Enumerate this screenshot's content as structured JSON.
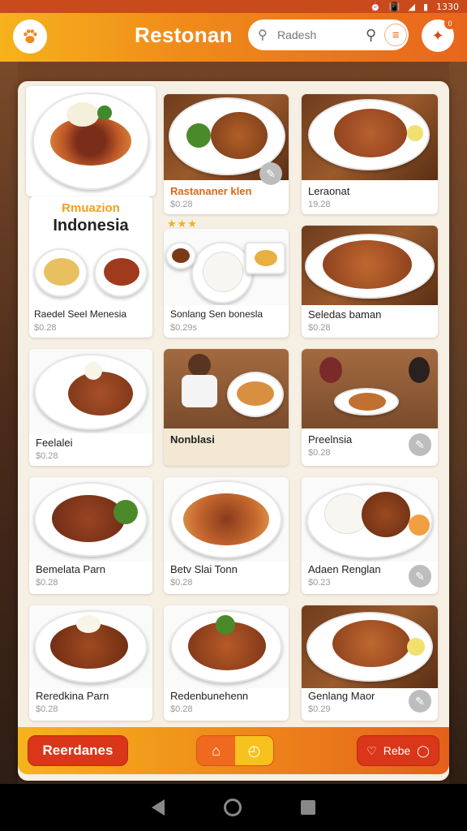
{
  "status_bar": {
    "time": "1330",
    "icons": [
      "alarm-icon",
      "vibrate-icon",
      "wifi-icon",
      "signal-icon",
      "battery-icon"
    ]
  },
  "header": {
    "title": "Restonan",
    "search_placeholder": "Radesh",
    "logo_icon": "paw-icon",
    "search_icon": "search-icon",
    "menu_icon": "menu-icon",
    "fav_icon": "star-icon",
    "fav_badge": "0"
  },
  "promo": {
    "subtitle": "Rmuazion",
    "title": "Indonesia",
    "stars": "★★★"
  },
  "items": [
    {
      "name": "Rastananer klen",
      "price": "$0.28",
      "highlight": true
    },
    {
      "name": "Leraonat",
      "price": "19.28"
    },
    {
      "name": "Raedel Seel Menesia",
      "price": "$0.28"
    },
    {
      "name": "Sonlang Sen bonesla",
      "price": "$0.29s"
    },
    {
      "name": "Seledas baman",
      "price": "$0.28"
    },
    {
      "name": "Feelalei",
      "price": "$0.28"
    },
    {
      "name": "Nonblasi",
      "price": ""
    },
    {
      "name": "Preelnsia",
      "price": "$0.28"
    },
    {
      "name": "Bemelata Parn",
      "price": "$0.28"
    },
    {
      "name": "Betv Slai Tonn",
      "price": "$0.28"
    },
    {
      "name": "Adaen Renglan",
      "price": "$0.23"
    },
    {
      "name": "Reredkina Parn",
      "price": "$0.28"
    },
    {
      "name": "Redenbunehenn",
      "price": "$0.28"
    },
    {
      "name": "Genlang Maor",
      "price": "$0.29"
    }
  ],
  "bottom_bar": {
    "left_label": "Reerdanes",
    "right_label": "Rebe",
    "home_icon": "home-icon",
    "timer_icon": "timer-icon",
    "heart_icon": "heart-icon",
    "chat_icon": "chat-icon"
  },
  "colors": {
    "accent": "#f08a1a",
    "brand_red": "#d9361a",
    "highlight_text": "#d9681a"
  }
}
